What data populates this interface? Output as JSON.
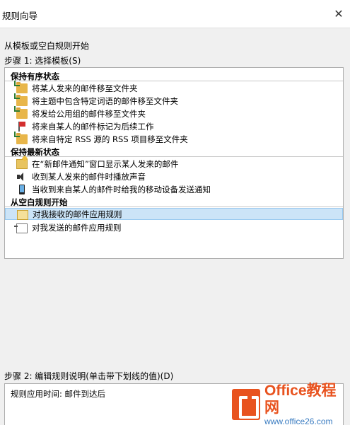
{
  "window": {
    "title": "规则向导",
    "close_glyph": "✕"
  },
  "start_label": "从模板或空白规则开始",
  "step1_label": "步骤 1: 选择模板(S)",
  "groups": [
    {
      "header": "保持有序状态"
    },
    {
      "header": "保持最新状态"
    },
    {
      "header": "从空白规则开始"
    }
  ],
  "items": [
    {
      "label": "将某人发来的邮件移至文件夹",
      "icon": "folder-move-icon"
    },
    {
      "label": "将主题中包含特定词语的邮件移至文件夹",
      "icon": "folder-move-icon"
    },
    {
      "label": "将发给公用组的邮件移至文件夹",
      "icon": "folder-move-icon"
    },
    {
      "label": "将来自某人的邮件标记为后续工作",
      "icon": "flag-icon"
    },
    {
      "label": "将来自特定 RSS 源的 RSS 项目移至文件夹",
      "icon": "folder-move-icon"
    },
    {
      "label": "在“新邮件通知”窗口显示某人发来的邮件",
      "icon": "envelope-star-icon"
    },
    {
      "label": "收到某人发来的邮件时播放声音",
      "icon": "speaker-icon"
    },
    {
      "label": "当收到来自某人的邮件时给我的移动设备发送通知",
      "icon": "mobile-device-icon"
    },
    {
      "label": "对我接收的邮件应用规则",
      "icon": "inbox-icon",
      "selected": true
    },
    {
      "label": "对我发送的邮件应用规则",
      "icon": "outbox-icon"
    }
  ],
  "step2_label": "步骤 2: 编辑规则说明(单击带下划线的值)(D)",
  "rule_description": "规则应用时间: 邮件到达后",
  "watermark": {
    "main": "Office教程网",
    "sub": "www.office26.com"
  }
}
